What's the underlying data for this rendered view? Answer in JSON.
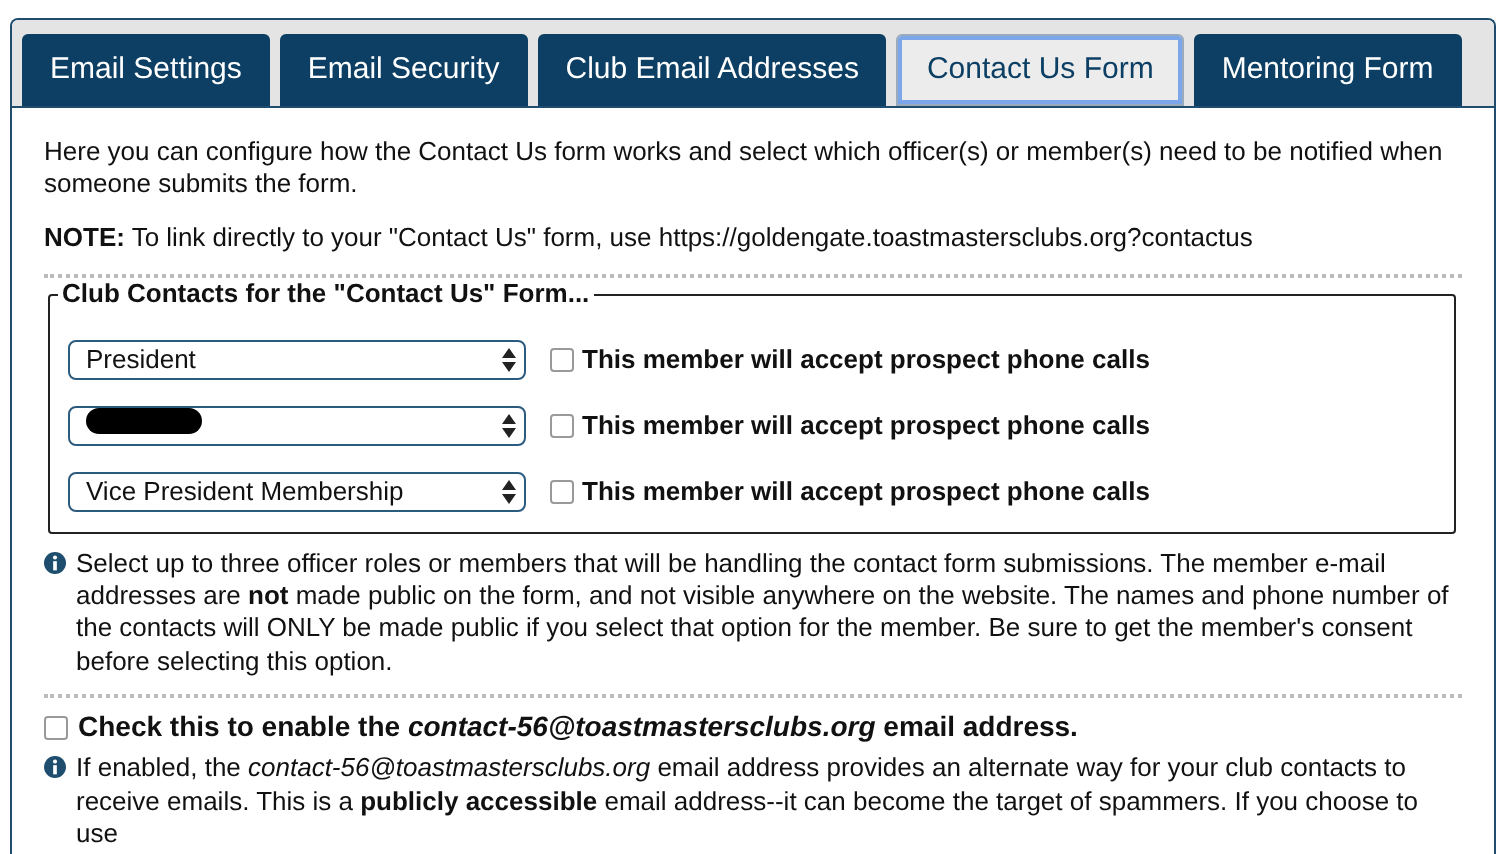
{
  "tabs": [
    {
      "label": "Email Settings",
      "selected": false
    },
    {
      "label": "Email Security",
      "selected": false
    },
    {
      "label": "Club Email Addresses",
      "selected": false
    },
    {
      "label": "Contact Us Form",
      "selected": true
    },
    {
      "label": "Mentoring Form",
      "selected": false
    }
  ],
  "intro": "Here you can configure how the Contact Us form works and select which officer(s) or member(s) need to be notified when someone submits the form.",
  "note": "**NOTE:** To link directly to your \"Contact Us\" form, use https://goldengate.toastmastersclubs.org?contactus",
  "contacts": {
    "legend": "Club Contacts for the \"Contact Us\" Form...",
    "rows": [
      {
        "value": "President",
        "redacted": false,
        "checked": false,
        "label": "This member will accept prospect phone calls"
      },
      {
        "redacted": true,
        "checked": false,
        "label": "This member will accept prospect phone calls"
      },
      {
        "value": "Vice President Membership",
        "redacted": false,
        "checked": false,
        "label": "This member will accept prospect phone calls"
      }
    ]
  },
  "contacts_info": "Select up to three officer roles or members that will be handling the contact form submissions. The member e-mail addresses are **not** made public on the form, and not visible anywhere on the website. The names and phone number of the contacts will ONLY be made public if you select that option for the member. Be sure to get the member's consent before selecting this option.",
  "enable_option": {
    "checked": false,
    "label": "Check this to enable the *contact-56@toastmastersclubs.org* email address."
  },
  "enable_info": "If enabled, the *contact-56@toastmastersclubs.org* email address provides an alternate way for your club contacts to receive emails. This is a **publicly accessible** email address--it can become the target of spammers. If you choose to use"
}
